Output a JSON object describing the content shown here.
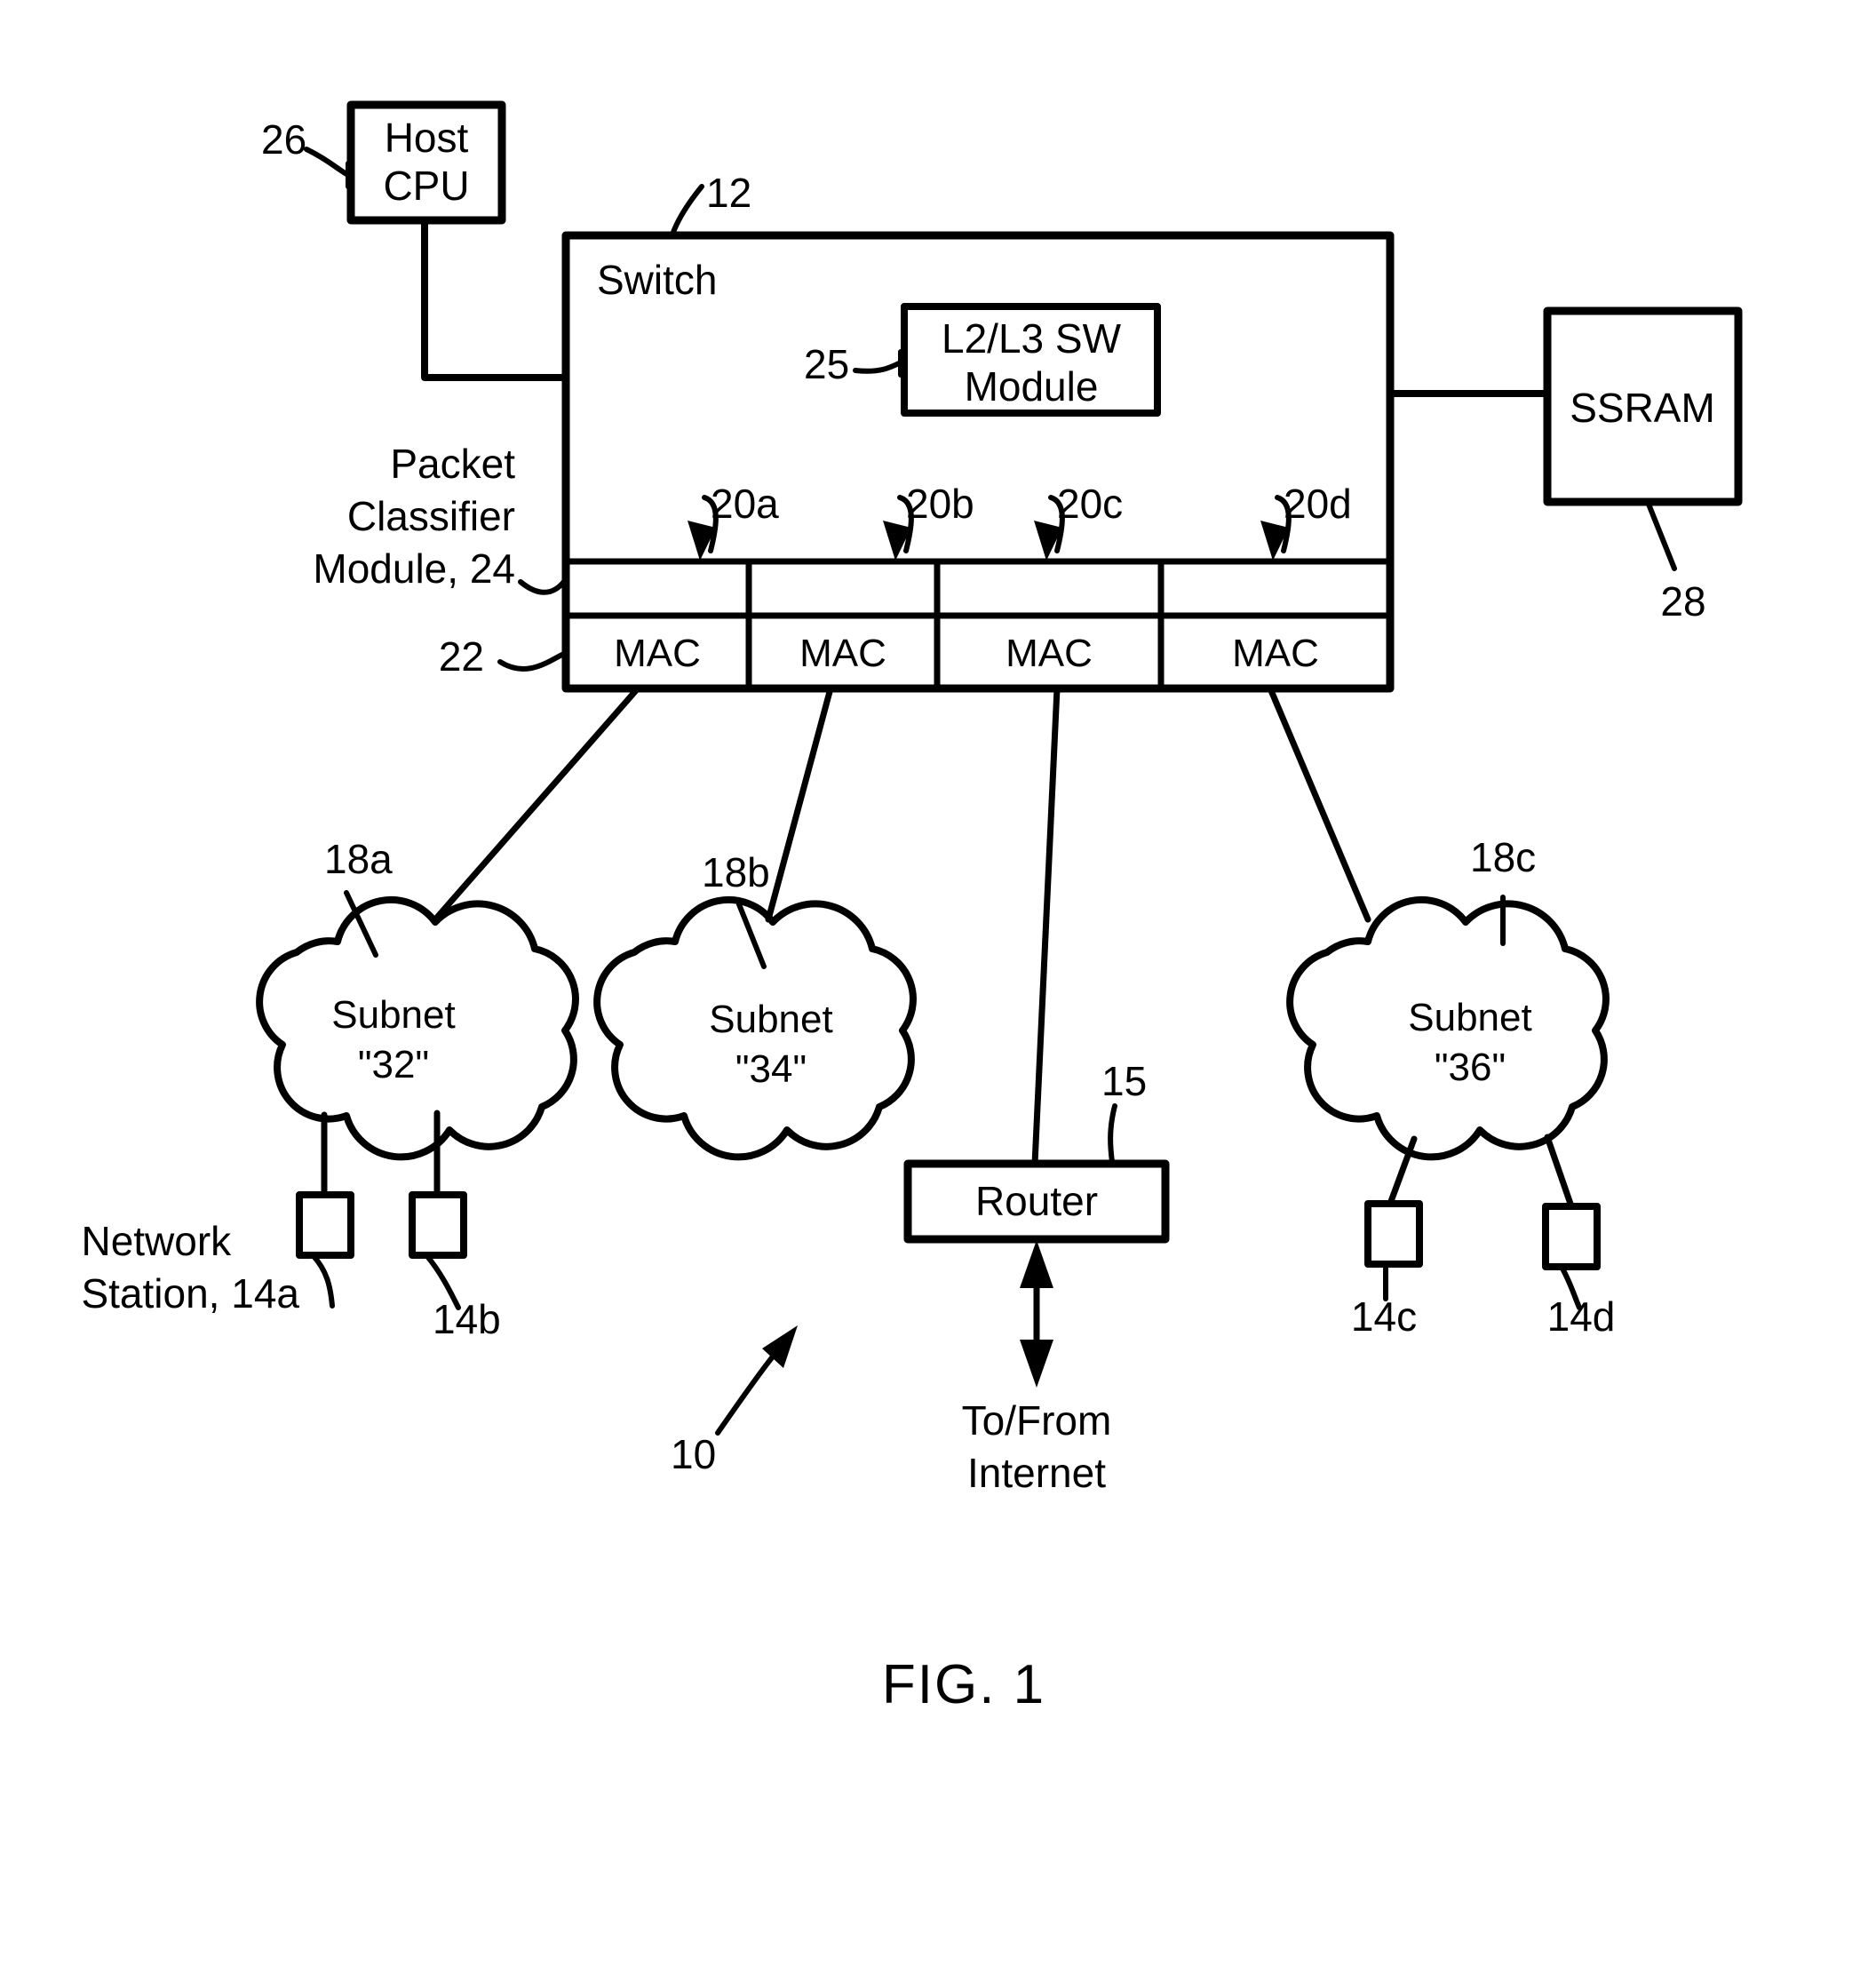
{
  "figure": {
    "caption": "FIG. 1",
    "system_ref": "10"
  },
  "blocks": {
    "host_cpu": {
      "label": "Host\nCPU",
      "ref": "26"
    },
    "switch": {
      "label": "Switch",
      "ref": "12"
    },
    "sw_module": {
      "label": "L2/L3 SW\nModule",
      "ref": "25"
    },
    "ssram": {
      "label": "SSRAM",
      "ref": "28"
    },
    "router": {
      "label": "Router",
      "ref": "15"
    }
  },
  "switch_internals": {
    "classifier_label": "Packet\nClassifier\nModule, 24",
    "mac_row_ref": "22",
    "ports": [
      {
        "ref": "20a",
        "mac_label": "MAC"
      },
      {
        "ref": "20b",
        "mac_label": "MAC"
      },
      {
        "ref": "20c",
        "mac_label": "MAC"
      },
      {
        "ref": "20d",
        "mac_label": "MAC"
      }
    ]
  },
  "subnets": [
    {
      "ref": "18a",
      "name": "Subnet",
      "id": "\"32\""
    },
    {
      "ref": "18b",
      "name": "Subnet",
      "id": "\"34\""
    },
    {
      "ref": "18c",
      "name": "Subnet",
      "id": "\"36\""
    }
  ],
  "stations": [
    {
      "ref": "14a",
      "caption": "Network\nStation, 14a"
    },
    {
      "ref": "14b",
      "caption": "14b"
    },
    {
      "ref": "14c",
      "caption": "14c"
    },
    {
      "ref": "14d",
      "caption": "14d"
    }
  ],
  "internet": {
    "label": "To/From\nInternet"
  },
  "colors": {
    "ink": "#000000",
    "paper": "#ffffff"
  }
}
